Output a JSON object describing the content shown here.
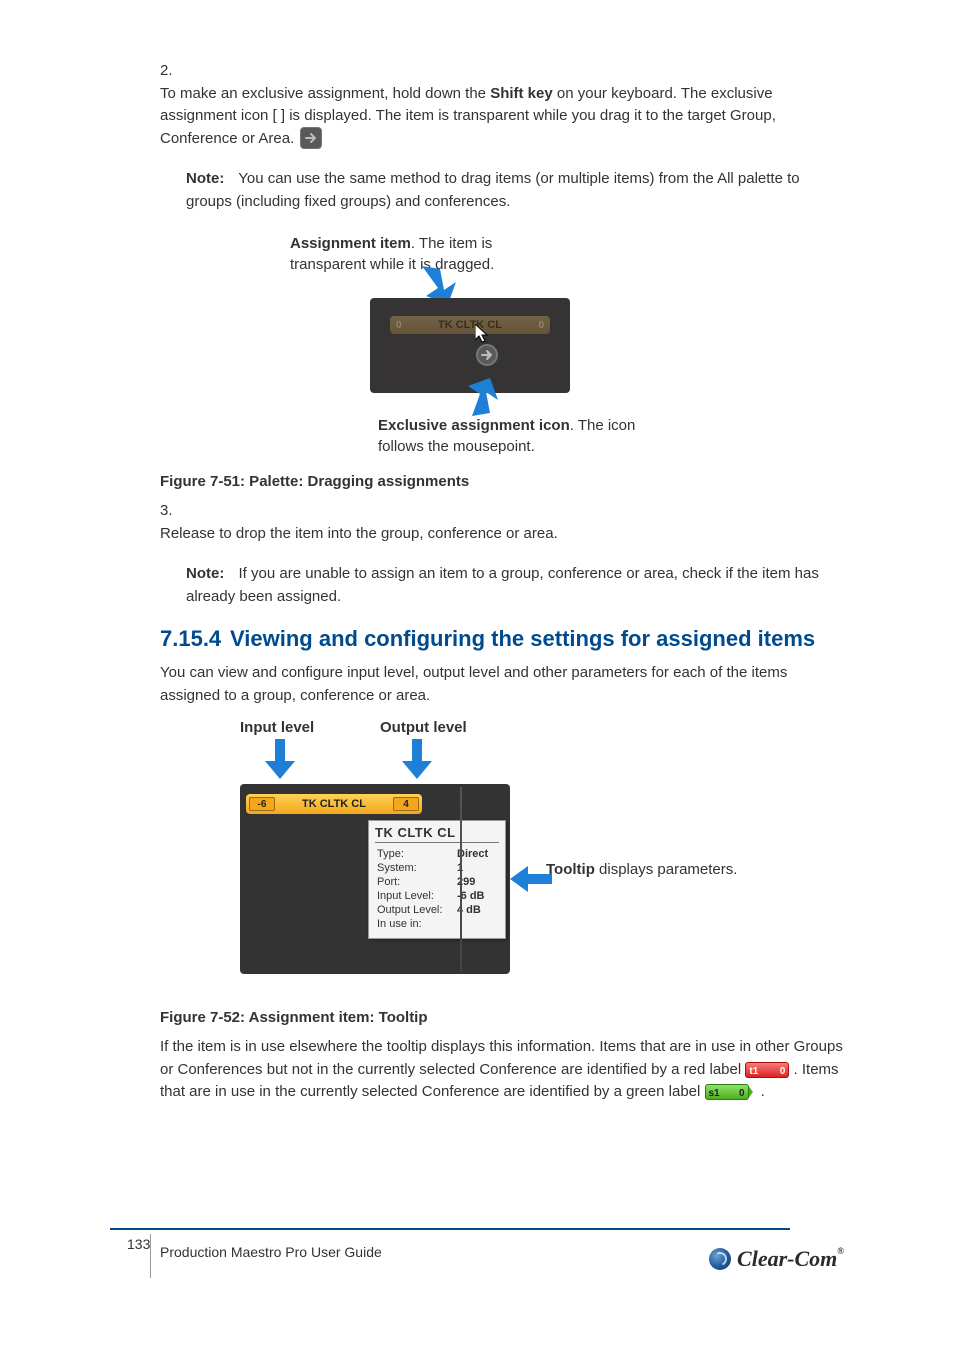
{
  "list": {
    "n2": "2.",
    "t2_a": "To make an exclusive assignment, hold down the ",
    "t2_b": "Shift key ",
    "t2_c": "on your keyboard. The exclusive assignment icon [        ] is displayed. The item is transparent while you drag it to the target Group, Conference or Area.",
    "note_a_lbl": "Note:",
    "note_a": "You can use the same method to drag items (or multiple items) from the All palette to groups (including fixed groups) and conferences.",
    "n3": "3.",
    "t3": "Release to drop the item into the group, conference or area.",
    "note_b_lbl": "Note:",
    "note_b": "If you are unable to assign an item to a group, conference or area, check if the item has already been assigned.",
    "cap1": "Figure 7-51: Palette: Dragging assignments"
  },
  "fig1": {
    "cap_top_bold": "Assignment item",
    "cap_top_rest": ". The item is transparent while it is dragged.",
    "drag_label": "TK CLTK CL",
    "drag_lvl_l": "0",
    "drag_lvl_r": "0",
    "cap_bot_bold": "Exclusive assignment icon",
    "cap_bot_rest": ". The icon follows the mousepoint."
  },
  "section": {
    "num": "7.15.4",
    "title": "Viewing and configuring the settings for assigned items",
    "p": "You can view and configure input level, output level and other parameters for each of the items assigned to a group, conference or area.",
    "cap2": "Figure 7-52: Assignment item: Tooltip"
  },
  "fig2": {
    "lbl_in": "Input level",
    "lbl_out": "Output level",
    "in_val": "-6",
    "mid": "TK CLTK CL",
    "out_val": "4",
    "tooltip_title": "TK CLTK CL",
    "rows": [
      {
        "k": "Type:",
        "v": "Direct"
      },
      {
        "k": "System:",
        "v": "1"
      },
      {
        "k": "Port:",
        "v": "299"
      },
      {
        "k": "Input Level:",
        "v": "-6 dB"
      },
      {
        "k": "Output Level:",
        "v": "4 dB"
      },
      {
        "k": "In use in:",
        "v": ""
      }
    ],
    "side_bold": "Tooltip",
    "side_rest": " displays parameters."
  },
  "para2": {
    "a": "If the item is in use elsewhere the tooltip displays this information. Items that are in use in other Groups or Conferences but not in the currently selected Conference are identified by a red label ",
    "b": ". Items that are in use in the currently selected Conference are identified by a green label ",
    "c": ".",
    "red_l": "t1",
    "red_r": "0",
    "green_l": "s1",
    "green_r": "0"
  },
  "footer": {
    "page": "133",
    "text": "Production Maestro Pro User Guide",
    "brand": "Clear-Com"
  }
}
